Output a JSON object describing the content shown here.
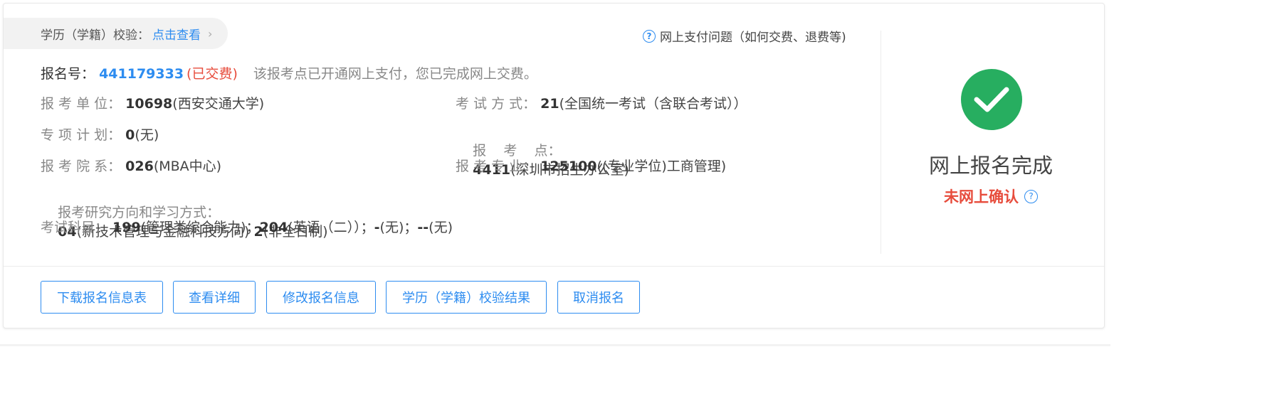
{
  "verify": {
    "label": "学历（学籍）校验：",
    "link": "点击查看",
    "chevron": "›"
  },
  "payment_help": {
    "icon": "question-circle-icon",
    "text": "网上支付问题（如何交费、退费等)"
  },
  "registration": {
    "label": "报名号：",
    "number": "441179333",
    "paid_status": "(已交费)",
    "note": "该报考点已开通网上支付，您已完成网上交费。"
  },
  "fields": {
    "unit_label": "报 考 单 位：",
    "unit_code": "10698",
    "unit_name": "(西安交通大学)",
    "exam_mode_label": "考 试 方 式：",
    "exam_mode_code": "21",
    "exam_mode_name": "(全国统一考试（含联合考试））",
    "special_plan_label": "专 项 计 划：",
    "special_plan_code": "0",
    "special_plan_name": "(无)",
    "exam_site_label": "报    考    点：",
    "exam_site_code": "4411",
    "exam_site_name": "(深圳市招生办公室)",
    "dept_label": "报 考 院 系：",
    "dept_code": "026",
    "dept_name": "(MBA中心)",
    "major_label": "报 考 专 业：",
    "major_code": "125100",
    "major_name": "((专业学位)工商管理)",
    "direction_label": "报考研究方向和学习方式：",
    "direction_code": "04",
    "direction_name": "(新技术管理与金融科技方向) ",
    "study_mode_code": "2",
    "study_mode_name": "(非全日制)",
    "subjects_label": "考试科目：",
    "subjects": [
      {
        "code": "199",
        "name": "(管理类综合能力)；"
      },
      {
        "code": "204",
        "name": "(英语（二））；"
      },
      {
        "code": "-",
        "name": "(无)；"
      },
      {
        "code": "--",
        "name": "(无)"
      }
    ]
  },
  "status": {
    "title": "网上报名完成",
    "subtitle": "未网上确认",
    "check_color": "#27ae60",
    "warn_color": "#e74c3c"
  },
  "buttons": {
    "download": "下载报名信息表",
    "details": "查看详细",
    "modify": "修改报名信息",
    "verify_result": "学历（学籍）校验结果",
    "cancel": "取消报名"
  },
  "colors": {
    "accent": "#2d8cf0"
  }
}
